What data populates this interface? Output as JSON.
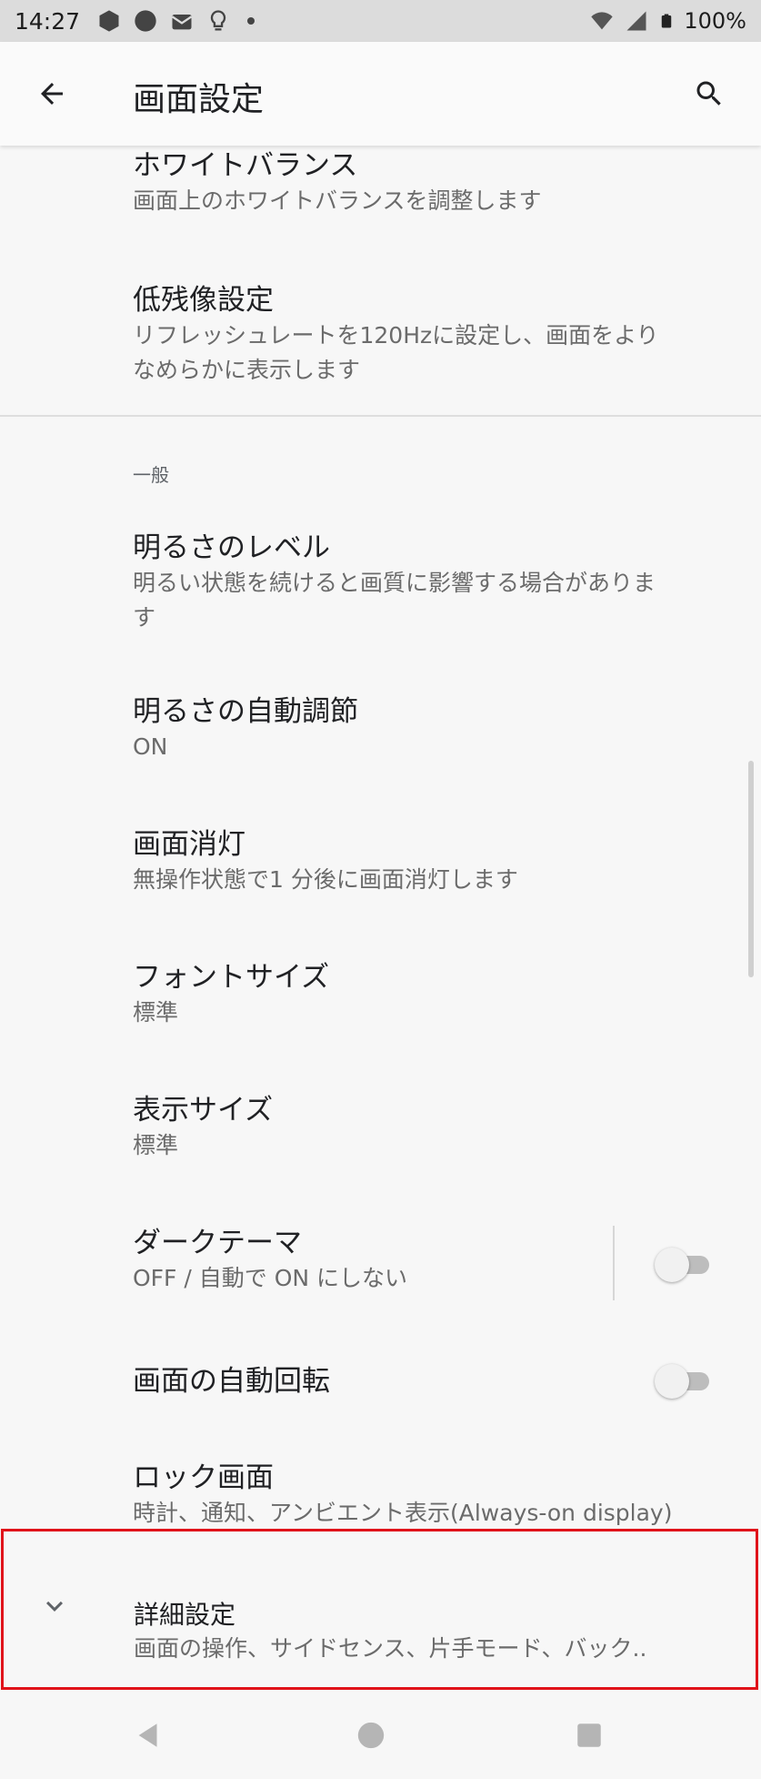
{
  "status_bar": {
    "time": "14:27",
    "battery": "100%"
  },
  "app_bar": {
    "title": "画面設定",
    "back_icon": "back-arrow-icon",
    "search_icon": "search-icon"
  },
  "items_top": [
    {
      "title": "ホワイトバランス",
      "summary": "画面上のホワイトバランスを調整します"
    },
    {
      "title": "低残像設定",
      "summary_line1": "リフレッシュレートを120Hzに設定し、画面をより",
      "summary_line2": "なめらかに表示します"
    }
  ],
  "section": {
    "header": "一般"
  },
  "items": [
    {
      "title": "明るさのレベル",
      "summary_line1": "明るい状態を続けると画質に影響する場合がありま",
      "summary_line2": "す"
    },
    {
      "title": "明るさの自動調節",
      "summary": "ON"
    },
    {
      "title": "画面消灯",
      "summary": "無操作状態で1 分後に画面消灯します"
    },
    {
      "title": "フォントサイズ",
      "summary": "標準"
    },
    {
      "title": "表示サイズ",
      "summary": "標準"
    },
    {
      "title": "ダークテーマ",
      "summary": "OFF / 自動で ON にしない",
      "toggle": false
    },
    {
      "title": "画面の自動回転",
      "toggle": false
    },
    {
      "title": "ロック画面",
      "summary": "時計、通知、アンビエント表示(Always-on display)"
    }
  ],
  "advanced": {
    "title": "詳細設定",
    "summary": "画面の操作、サイドセンス、片手モード、バック..",
    "icon": "chevron-down-icon"
  },
  "colors": {
    "highlight_border": "#e0131a",
    "toggle_track_off": "#bdbdbd",
    "toggle_thumb_off": "#f1f1f1"
  }
}
